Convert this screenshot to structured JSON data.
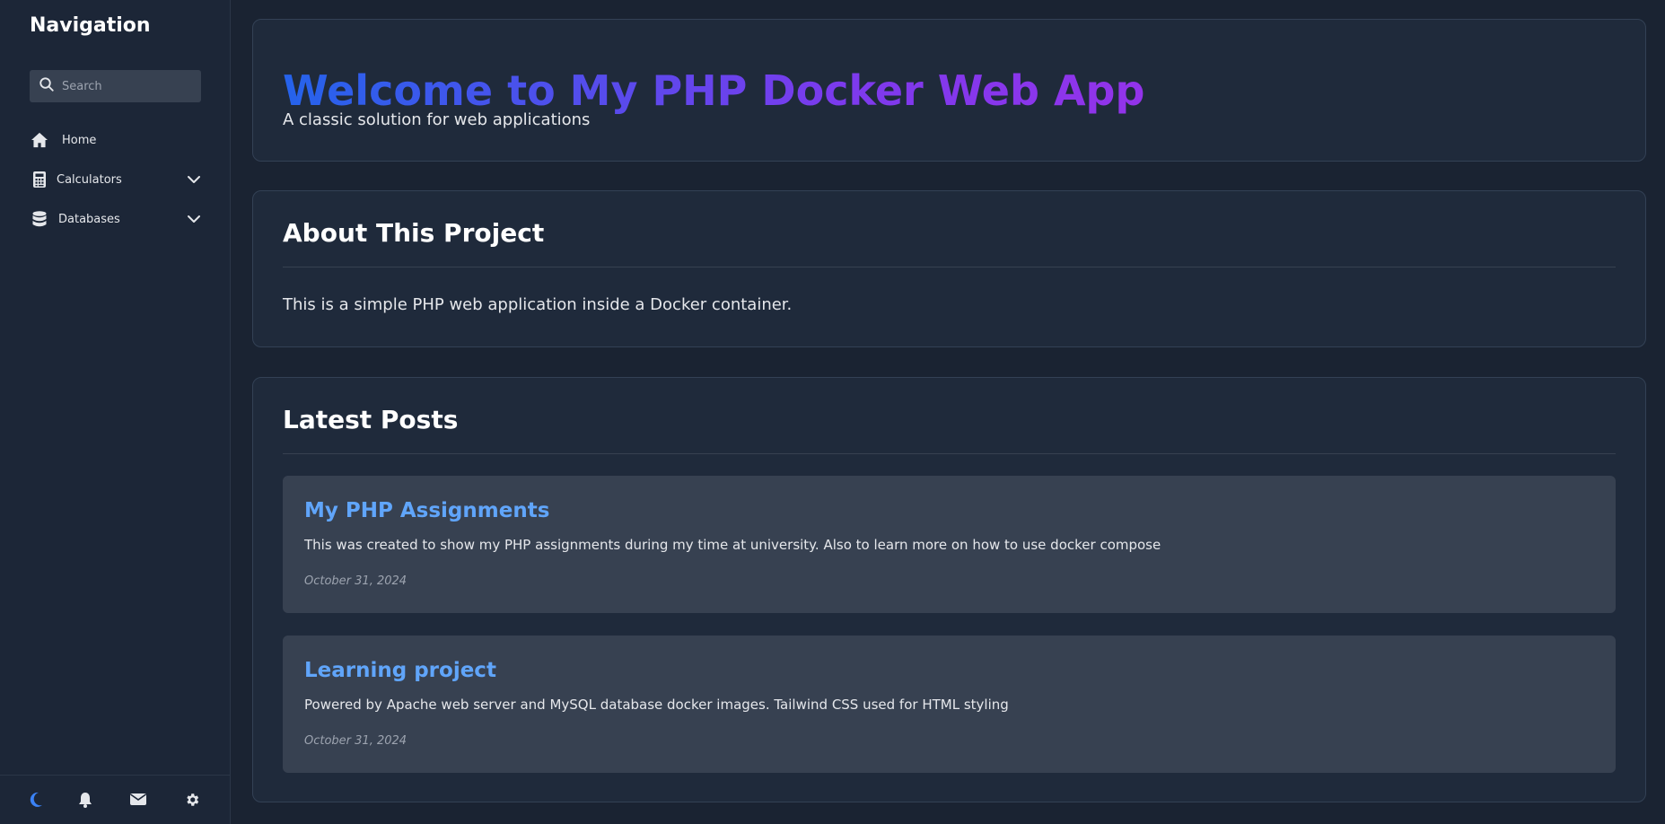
{
  "sidebar": {
    "title": "Navigation",
    "search_placeholder": "Search",
    "items": [
      {
        "label": "Home",
        "icon": "home-icon"
      },
      {
        "label": "Calculators",
        "icon": "calculator-icon",
        "expandable": true
      },
      {
        "label": "Databases",
        "icon": "database-icon",
        "expandable": true
      }
    ],
    "bottom_icons": [
      "moon-icon",
      "bell-icon",
      "mail-icon",
      "gear-icon"
    ]
  },
  "hero": {
    "title": "Welcome to My PHP Docker Web App",
    "subtitle": "A classic solution for web applications"
  },
  "about": {
    "title": "About This Project",
    "text": "This is a simple PHP web application inside a Docker container."
  },
  "posts": {
    "title": "Latest Posts",
    "items": [
      {
        "title": "My PHP Assignments",
        "body": "This was created to show my PHP assignments during my time at university. Also to learn more on how to use docker compose",
        "date": "October 31, 2024"
      },
      {
        "title": "Learning project",
        "body": "Powered by Apache web server and MySQL database docker images. Tailwind CSS used for HTML styling",
        "date": "October 31, 2024"
      }
    ]
  },
  "colors": {
    "background": "#1a2332",
    "card": "#1f2a3b",
    "post_card": "#374151",
    "link": "#60a5fa",
    "gradient_start": "#2563eb",
    "gradient_end": "#9333ea",
    "moon_accent": "#3b82f6"
  }
}
